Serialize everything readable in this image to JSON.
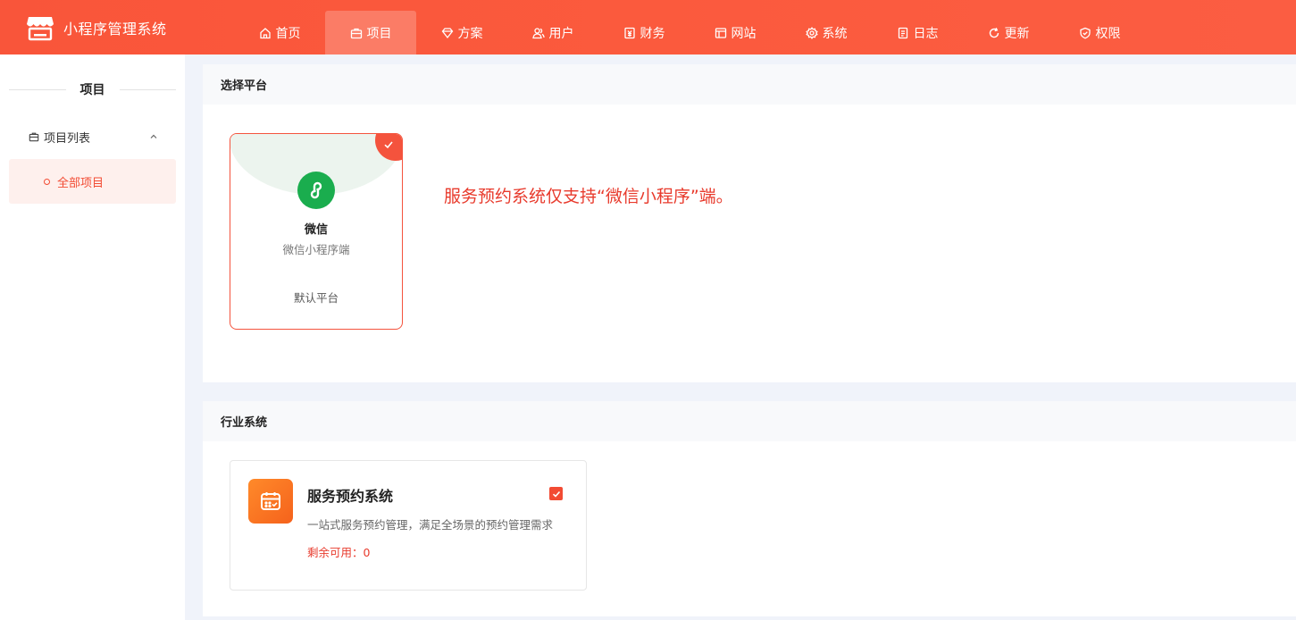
{
  "brand": {
    "title": "小程序管理系统",
    "logo_icon": "store-icon"
  },
  "nav": [
    {
      "label": "首页",
      "icon": "home-icon",
      "active": false
    },
    {
      "label": "项目",
      "icon": "briefcase-icon",
      "active": true
    },
    {
      "label": "方案",
      "icon": "diamond-icon",
      "active": false
    },
    {
      "label": "用户",
      "icon": "users-icon",
      "active": false
    },
    {
      "label": "财务",
      "icon": "finance-icon",
      "active": false
    },
    {
      "label": "网站",
      "icon": "layout-icon",
      "active": false
    },
    {
      "label": "系统",
      "icon": "gear-icon",
      "active": false
    },
    {
      "label": "日志",
      "icon": "document-icon",
      "active": false
    },
    {
      "label": "更新",
      "icon": "refresh-icon",
      "active": false
    },
    {
      "label": "权限",
      "icon": "shield-check-icon",
      "active": false
    }
  ],
  "sidebar": {
    "heading": "项目",
    "group": {
      "label": "项目列表",
      "icon": "briefcase-icon",
      "expanded": true
    },
    "items": [
      {
        "label": "全部项目",
        "active": true
      }
    ]
  },
  "platform_section": {
    "heading": "选择平台",
    "card": {
      "name": "微信",
      "subtitle": "微信小程序端",
      "tag": "默认平台",
      "icon": "wechat-miniprogram-icon",
      "selected": true
    },
    "notice": "服务预约系统仅支持“微信小程序”端。"
  },
  "industry_section": {
    "heading": "行业系统",
    "system": {
      "title": "服务预约系统",
      "description": "一站式服务预约管理，满足全场景的预约管理需求",
      "remaining": "剩余可用：0",
      "checked": true,
      "icon": "calendar-icon"
    }
  },
  "colors": {
    "primary": "#f9553a",
    "accent_text": "#e83a2c",
    "wechat_green": "#1aad4e"
  }
}
